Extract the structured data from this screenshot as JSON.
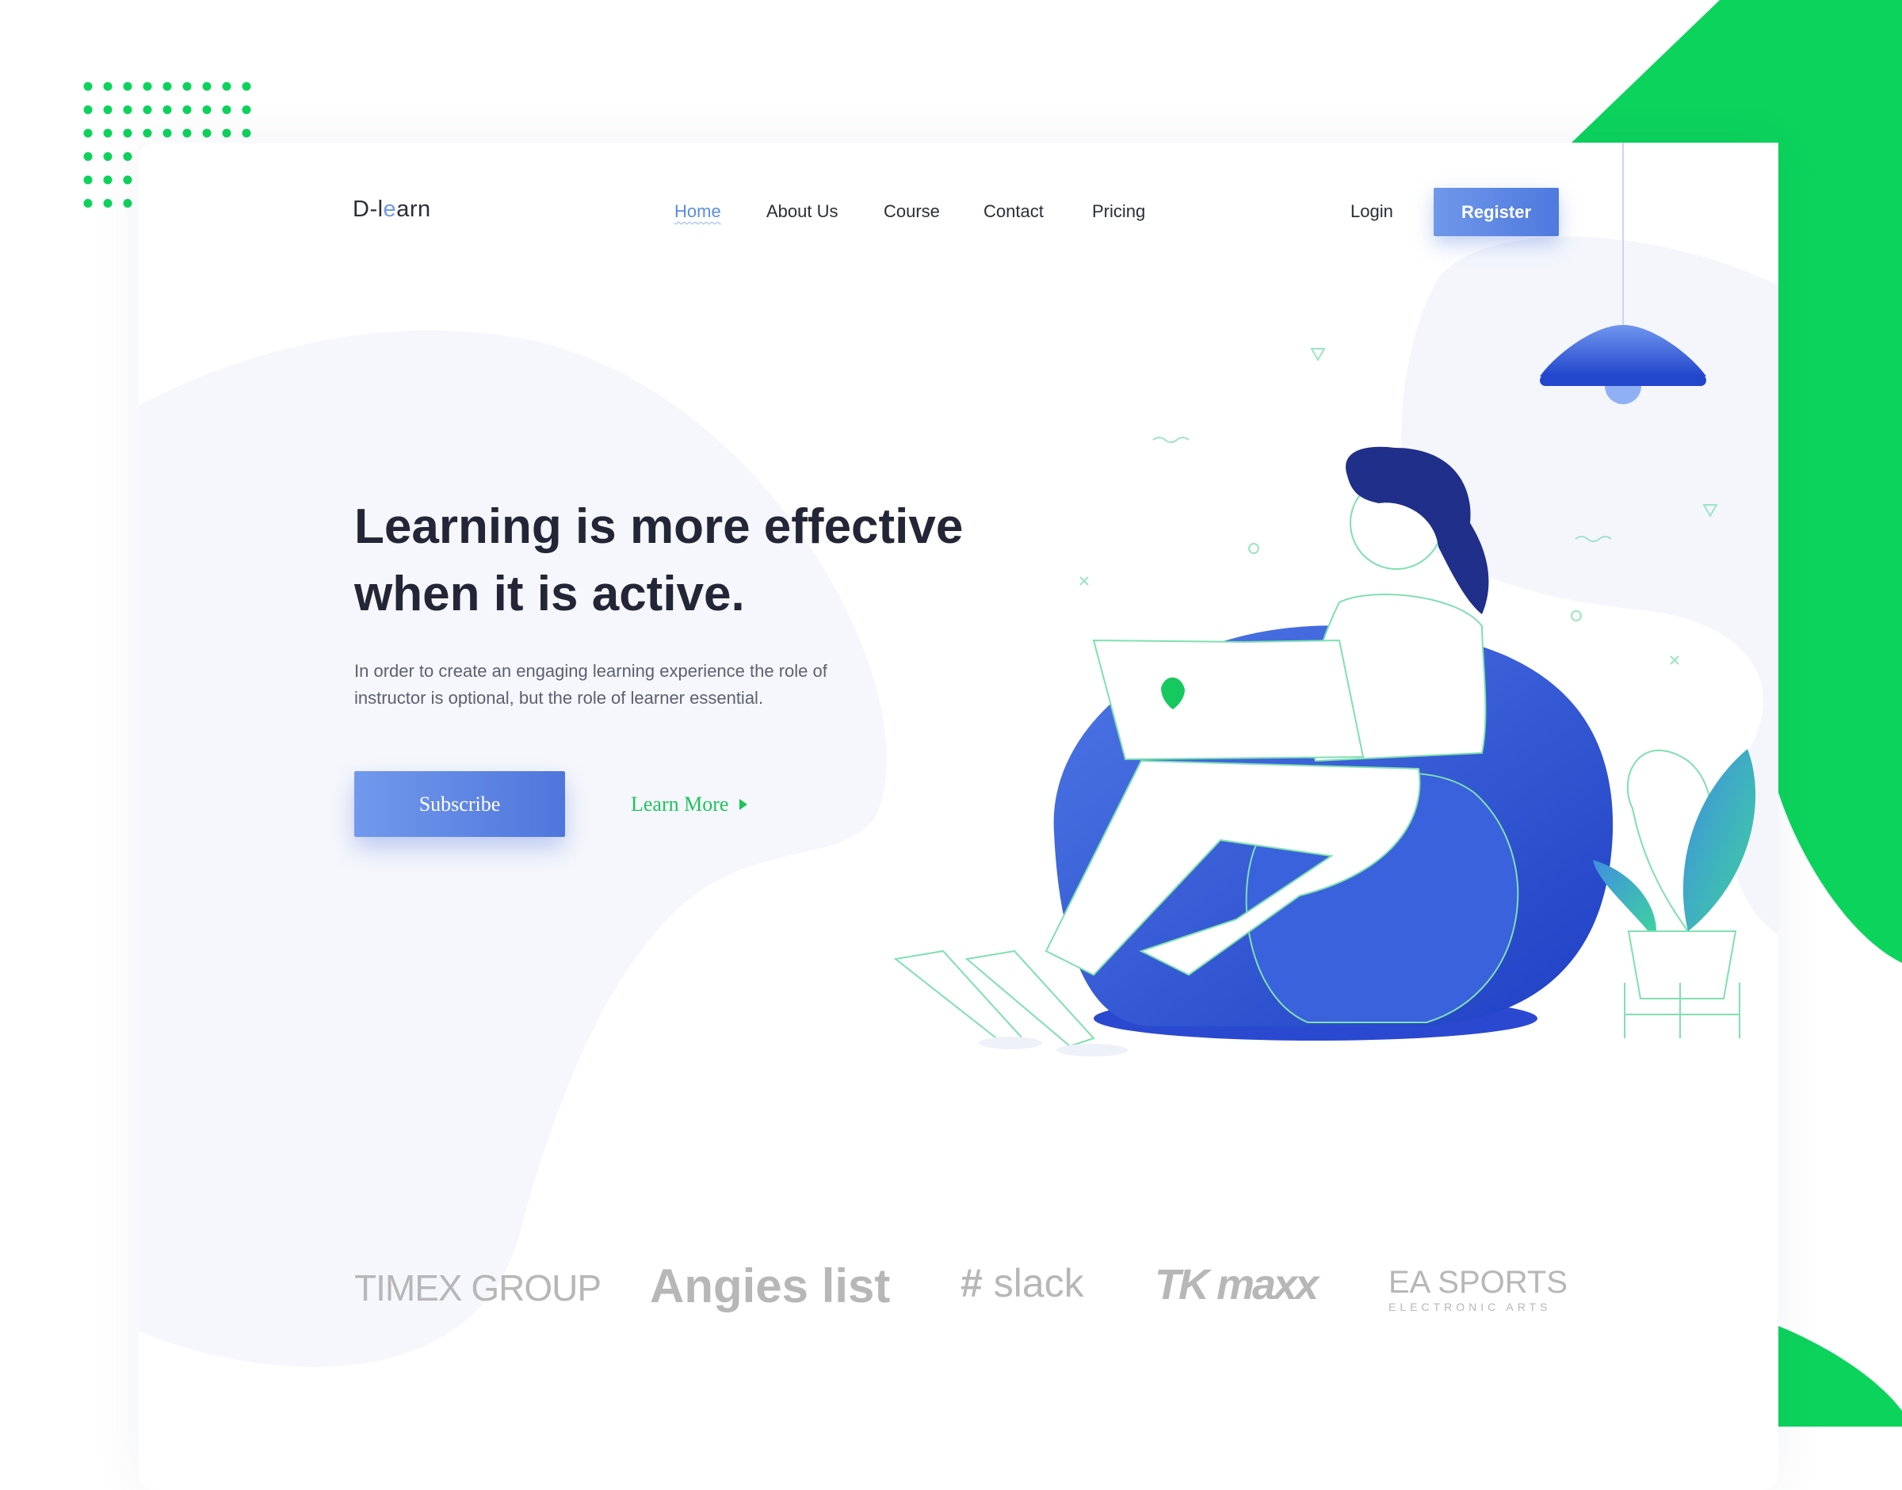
{
  "header": {
    "logo": "D-learn",
    "logo_parts": [
      "D-l",
      "e",
      "arn"
    ],
    "nav": [
      {
        "label": "Home",
        "active": true
      },
      {
        "label": "About Us"
      },
      {
        "label": "Course"
      },
      {
        "label": "Contact"
      },
      {
        "label": "Pricing"
      }
    ],
    "login": "Login",
    "register": "Register"
  },
  "hero": {
    "title_line1": "Learning is more effective",
    "title_line2": "when it is active.",
    "description_line1": "In order to create an engaging learning experience the role of",
    "description_line2": "instructor is optional, but the role of learner essential.",
    "subscribe": "Subscribe",
    "learn_more": "Learn More",
    "learn_more_icon": "caret-right-icon"
  },
  "brands": [
    "TIMEX GROUP",
    "Angies list",
    "slack",
    "TK maxx",
    "EA SPORTS",
    "ELECTRONIC ARTS"
  ],
  "colors": {
    "accent": "#5b84e3",
    "green": "#0cd35c",
    "beanbag": "#2f55d4"
  }
}
